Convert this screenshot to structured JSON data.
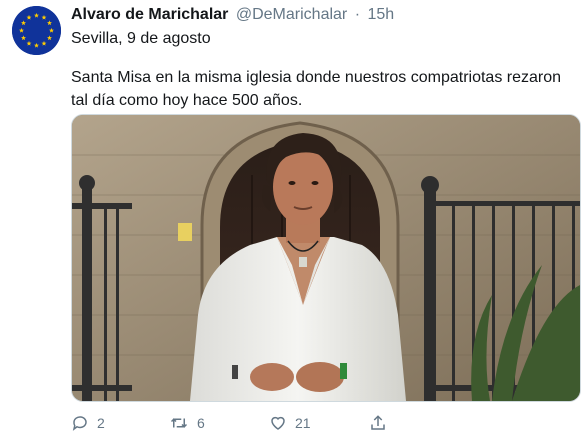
{
  "tweet": {
    "author_name": "Alvaro de Marichalar",
    "handle": "@DeMarichalar",
    "separator": "·",
    "time": "15h",
    "location_line": "Sevilla, 9 de agosto",
    "text": "Santa Misa en la misma iglesia donde nuestros compatriotas rezaron tal día como hoy hace 500 años.",
    "actions": {
      "reply_count": "2",
      "retweet_count": "6",
      "like_count": "21"
    }
  },
  "icons": [
    "eu-flag-avatar",
    "reply-icon",
    "retweet-icon",
    "like-icon",
    "share-icon"
  ],
  "colors": {
    "text": "#14171a",
    "secondary": "#657786",
    "avatar_bg": "#10339a",
    "avatar_stars": "#ffcc00"
  }
}
